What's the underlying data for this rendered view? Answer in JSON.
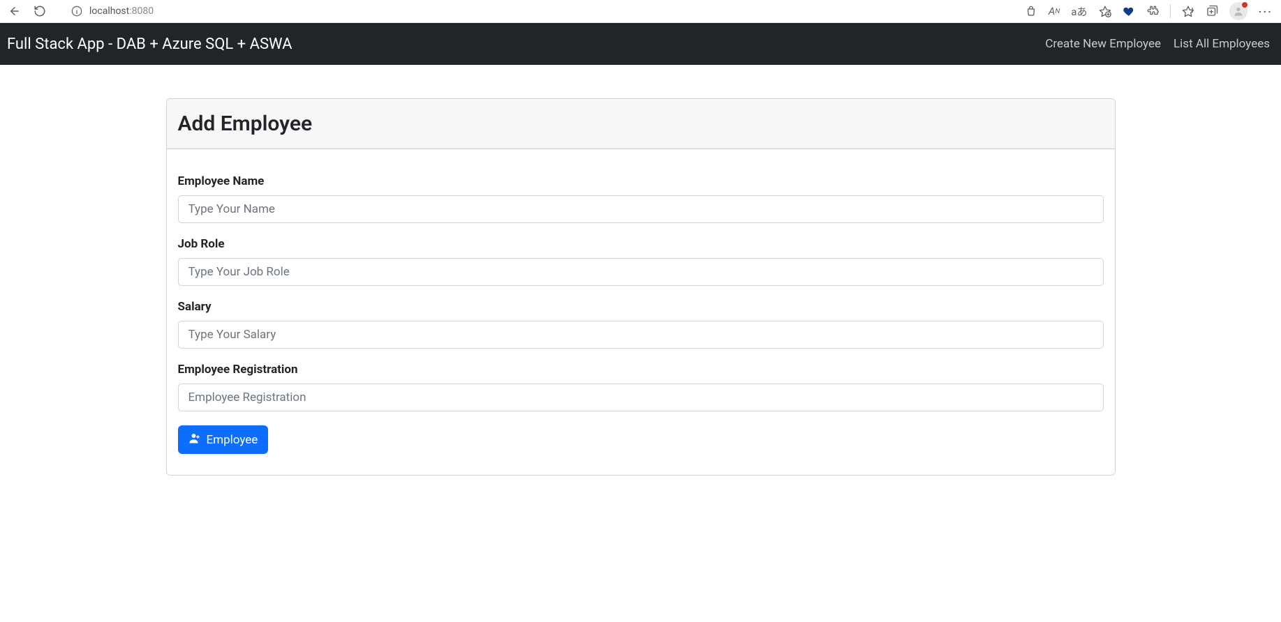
{
  "browser": {
    "url_host": "localhost",
    "url_port": ":8080"
  },
  "navbar": {
    "brand": "Full Stack App - DAB + Azure SQL + ASWA",
    "links": {
      "create": "Create New Employee",
      "list": "List All Employees"
    }
  },
  "card": {
    "title": "Add Employee"
  },
  "form": {
    "fields": {
      "name": {
        "label": "Employee Name",
        "placeholder": "Type Your Name",
        "value": ""
      },
      "job_role": {
        "label": "Job Role",
        "placeholder": "Type Your Job Role",
        "value": ""
      },
      "salary": {
        "label": "Salary",
        "placeholder": "Type Your Salary",
        "value": ""
      },
      "registration": {
        "label": "Employee Registration",
        "placeholder": "Employee Registration",
        "value": ""
      }
    },
    "submit": {
      "label": " Employee"
    }
  }
}
